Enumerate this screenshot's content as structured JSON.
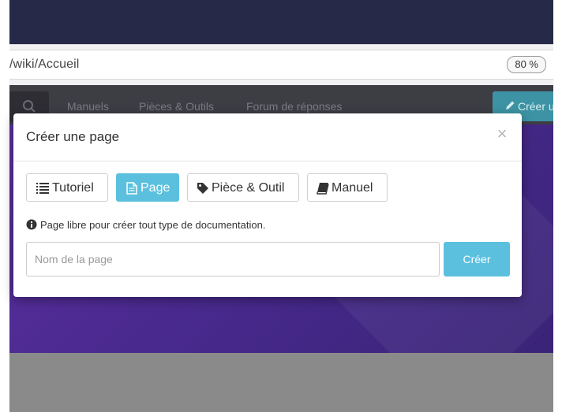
{
  "browser": {
    "url": "/wiki/Accueil",
    "zoom": "80 %"
  },
  "site_nav": {
    "search_icon": "search-icon",
    "links": [
      "Manuels",
      "Pièces & Outils",
      "Forum de réponses"
    ],
    "create_label": "Créer u"
  },
  "modal": {
    "title": "Créer une page",
    "close_symbol": "×",
    "types": [
      {
        "label": "Tutoriel",
        "icon": "list-icon",
        "active": false
      },
      {
        "label": "Page",
        "icon": "document-icon",
        "active": true
      },
      {
        "label": "Pièce & Outil",
        "icon": "tag-icon",
        "active": false
      },
      {
        "label": "Manuel",
        "icon": "book-icon",
        "active": false
      }
    ],
    "description": "Page libre pour créer tout type de documentation.",
    "name_placeholder": "Nom de la page",
    "name_value": "",
    "submit_label": "Créer"
  },
  "colors": {
    "accent": "#5bc0de",
    "titlebar": "#262a48",
    "hero": "#4a2a8e"
  }
}
